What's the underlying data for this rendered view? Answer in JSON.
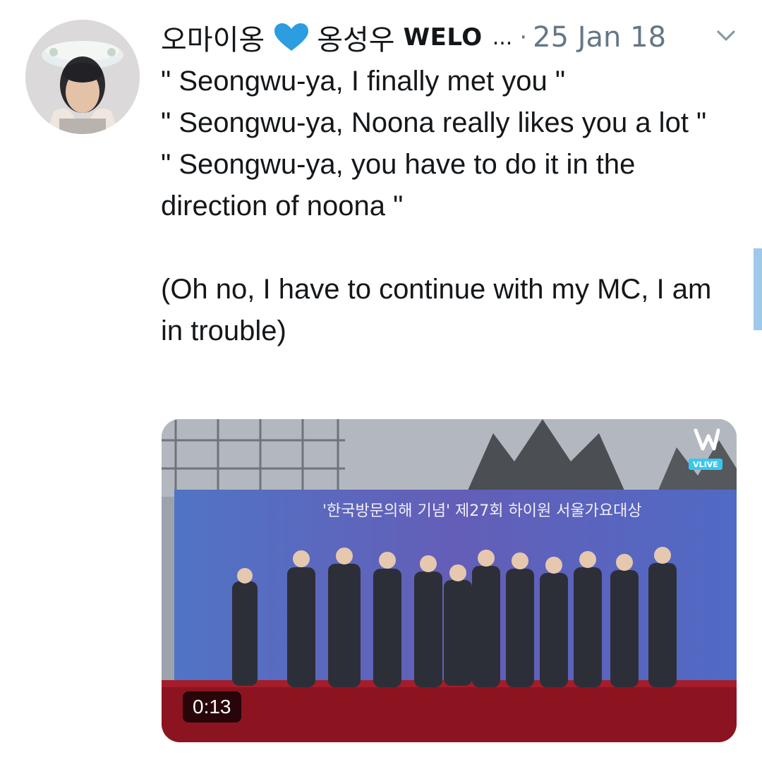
{
  "tweet": {
    "display_name": "오마이옹",
    "display_name_2": "옹성우",
    "display_name_3": "WELO",
    "ellipsis": "...",
    "separator": "·",
    "date": "25 Jan 18",
    "lines": [
      "\" Seongwu-ya, I finally met you \"",
      "\" Seongwu-ya, Noona really likes you a lot \"",
      "\" Seongwu-ya, you have to do it in the direction of noona \""
    ],
    "closing": "(Oh no, I have to continue with my MC, I am in trouble)"
  },
  "media": {
    "duration": "0:13",
    "badge": "VLIVE",
    "banner_text": "'한국방문의해 기념' 제27회 하이원 서울가요대상"
  },
  "icons": {
    "heart": "heart-icon",
    "chevron": "chevron-down-icon",
    "vlive": "vlive-logo-icon"
  },
  "colors": {
    "heart": "#2b9de0",
    "meta": "#657786",
    "text": "#14171a",
    "scroll": "#9fc8ea"
  }
}
